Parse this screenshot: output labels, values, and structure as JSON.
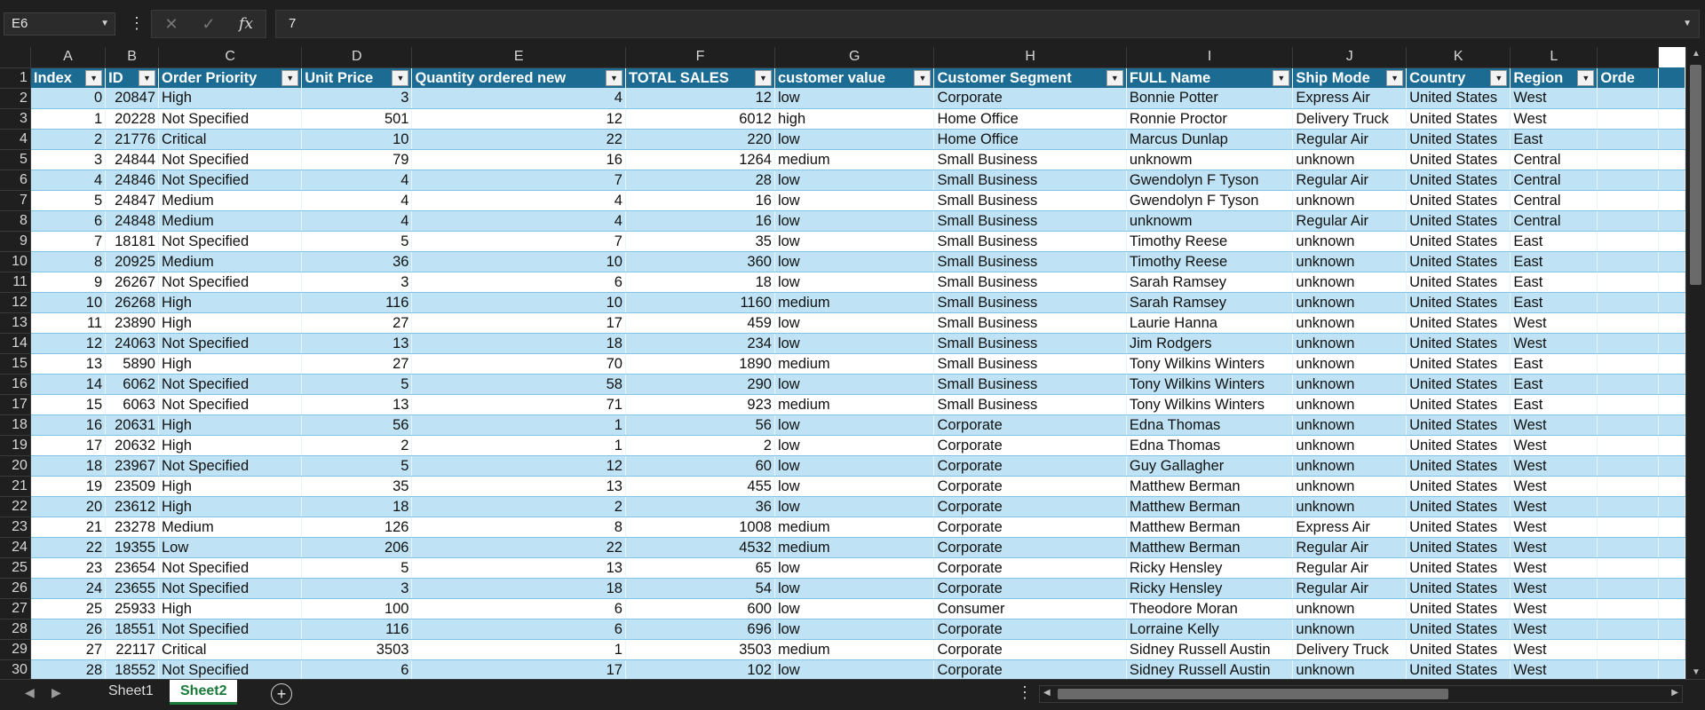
{
  "formula_bar": {
    "name_box": "E6",
    "formula_value": "7",
    "fx_label": "fx",
    "cancel_icon": "✕",
    "enter_icon": "✓"
  },
  "columns": [
    "A",
    "B",
    "C",
    "D",
    "E",
    "F",
    "G",
    "H",
    "I",
    "J",
    "K",
    "L",
    ""
  ],
  "headers": [
    "Index",
    "ID",
    "Order Priority",
    "Unit Price",
    "Quantity ordered new",
    "TOTAL SALES",
    "customer value",
    "Customer Segment",
    "FULL Name",
    "Ship Mode",
    "Country",
    "Region",
    "Orde"
  ],
  "header_row_number": "1",
  "rows": [
    {
      "n": "2",
      "v": [
        "0",
        "20847",
        "High",
        "3",
        "4",
        "12",
        "low",
        "Corporate",
        "Bonnie Potter",
        "Express Air",
        "United States",
        "West",
        ""
      ]
    },
    {
      "n": "3",
      "v": [
        "1",
        "20228",
        "Not Specified",
        "501",
        "12",
        "6012",
        "high",
        "Home Office",
        "Ronnie Proctor",
        "Delivery Truck",
        "United States",
        "West",
        ""
      ]
    },
    {
      "n": "4",
      "v": [
        "2",
        "21776",
        "Critical",
        "10",
        "22",
        "220",
        "low",
        "Home Office",
        "Marcus Dunlap",
        "Regular Air",
        "United States",
        "East",
        ""
      ]
    },
    {
      "n": "5",
      "v": [
        "3",
        "24844",
        "Not Specified",
        "79",
        "16",
        "1264",
        "medium",
        "Small Business",
        "unknowm",
        "unknown",
        "United States",
        "Central",
        ""
      ]
    },
    {
      "n": "6",
      "v": [
        "4",
        "24846",
        "Not Specified",
        "4",
        "7",
        "28",
        "low",
        "Small Business",
        "Gwendolyn F Tyson",
        "Regular Air",
        "United States",
        "Central",
        ""
      ]
    },
    {
      "n": "7",
      "v": [
        "5",
        "24847",
        "Medium",
        "4",
        "4",
        "16",
        "low",
        "Small Business",
        "Gwendolyn F Tyson",
        "unknown",
        "United States",
        "Central",
        ""
      ]
    },
    {
      "n": "8",
      "v": [
        "6",
        "24848",
        "Medium",
        "4",
        "4",
        "16",
        "low",
        "Small Business",
        "unknowm",
        "Regular Air",
        "United States",
        "Central",
        ""
      ]
    },
    {
      "n": "9",
      "v": [
        "7",
        "18181",
        "Not Specified",
        "5",
        "7",
        "35",
        "low",
        "Small Business",
        "Timothy Reese",
        "unknown",
        "United States",
        "East",
        ""
      ]
    },
    {
      "n": "10",
      "v": [
        "8",
        "20925",
        "Medium",
        "36",
        "10",
        "360",
        "low",
        "Small Business",
        "Timothy Reese",
        "unknown",
        "United States",
        "East",
        ""
      ]
    },
    {
      "n": "11",
      "v": [
        "9",
        "26267",
        "Not Specified",
        "3",
        "6",
        "18",
        "low",
        "Small Business",
        "Sarah Ramsey",
        "unknown",
        "United States",
        "East",
        ""
      ]
    },
    {
      "n": "12",
      "v": [
        "10",
        "26268",
        "High",
        "116",
        "10",
        "1160",
        "medium",
        "Small Business",
        "Sarah Ramsey",
        "unknown",
        "United States",
        "East",
        ""
      ]
    },
    {
      "n": "13",
      "v": [
        "11",
        "23890",
        "High",
        "27",
        "17",
        "459",
        "low",
        "Small Business",
        "Laurie Hanna",
        "unknown",
        "United States",
        "West",
        ""
      ]
    },
    {
      "n": "14",
      "v": [
        "12",
        "24063",
        "Not Specified",
        "13",
        "18",
        "234",
        "low",
        "Small Business",
        "Jim Rodgers",
        "unknown",
        "United States",
        "West",
        ""
      ]
    },
    {
      "n": "15",
      "v": [
        "13",
        "5890",
        "High",
        "27",
        "70",
        "1890",
        "medium",
        "Small Business",
        "Tony Wilkins Winters",
        "unknown",
        "United States",
        "East",
        ""
      ]
    },
    {
      "n": "16",
      "v": [
        "14",
        "6062",
        "Not Specified",
        "5",
        "58",
        "290",
        "low",
        "Small Business",
        "Tony Wilkins Winters",
        "unknown",
        "United States",
        "East",
        ""
      ]
    },
    {
      "n": "17",
      "v": [
        "15",
        "6063",
        "Not Specified",
        "13",
        "71",
        "923",
        "medium",
        "Small Business",
        "Tony Wilkins Winters",
        "unknown",
        "United States",
        "East",
        ""
      ]
    },
    {
      "n": "18",
      "v": [
        "16",
        "20631",
        "High",
        "56",
        "1",
        "56",
        "low",
        "Corporate",
        "Edna Thomas",
        "unknown",
        "United States",
        "West",
        ""
      ]
    },
    {
      "n": "19",
      "v": [
        "17",
        "20632",
        "High",
        "2",
        "1",
        "2",
        "low",
        "Corporate",
        "Edna Thomas",
        "unknown",
        "United States",
        "West",
        ""
      ]
    },
    {
      "n": "20",
      "v": [
        "18",
        "23967",
        "Not Specified",
        "5",
        "12",
        "60",
        "low",
        "Corporate",
        "Guy Gallagher",
        "unknown",
        "United States",
        "West",
        ""
      ]
    },
    {
      "n": "21",
      "v": [
        "19",
        "23509",
        "High",
        "35",
        "13",
        "455",
        "low",
        "Corporate",
        "Matthew Berman",
        "unknown",
        "United States",
        "West",
        ""
      ]
    },
    {
      "n": "22",
      "v": [
        "20",
        "23612",
        "High",
        "18",
        "2",
        "36",
        "low",
        "Corporate",
        "Matthew Berman",
        "unknown",
        "United States",
        "West",
        ""
      ]
    },
    {
      "n": "23",
      "v": [
        "21",
        "23278",
        "Medium",
        "126",
        "8",
        "1008",
        "medium",
        "Corporate",
        "Matthew Berman",
        "Express Air",
        "United States",
        "West",
        ""
      ]
    },
    {
      "n": "24",
      "v": [
        "22",
        "19355",
        "Low",
        "206",
        "22",
        "4532",
        "medium",
        "Corporate",
        "Matthew Berman",
        "Regular Air",
        "United States",
        "West",
        ""
      ]
    },
    {
      "n": "25",
      "v": [
        "23",
        "23654",
        "Not Specified",
        "5",
        "13",
        "65",
        "low",
        "Corporate",
        "Ricky Hensley",
        "Regular Air",
        "United States",
        "West",
        ""
      ]
    },
    {
      "n": "26",
      "v": [
        "24",
        "23655",
        "Not Specified",
        "3",
        "18",
        "54",
        "low",
        "Corporate",
        "Ricky Hensley",
        "Regular Air",
        "United States",
        "West",
        ""
      ]
    },
    {
      "n": "27",
      "v": [
        "25",
        "25933",
        "High",
        "100",
        "6",
        "600",
        "low",
        "Consumer",
        "Theodore Moran",
        "unknown",
        "United States",
        "West",
        ""
      ]
    },
    {
      "n": "28",
      "v": [
        "26",
        "18551",
        "Not Specified",
        "116",
        "6",
        "696",
        "low",
        "Corporate",
        "Lorraine Kelly",
        "unknown",
        "United States",
        "West",
        ""
      ]
    },
    {
      "n": "29",
      "v": [
        "27",
        "22117",
        "Critical",
        "3503",
        "1",
        "3503",
        "medium",
        "Corporate",
        "Sidney Russell Austin",
        "Delivery Truck",
        "United States",
        "West",
        ""
      ]
    },
    {
      "n": "30",
      "v": [
        "28",
        "18552",
        "Not Specified",
        "6",
        "17",
        "102",
        "low",
        "Corporate",
        "Sidney Russell Austin",
        "unknown",
        "United States",
        "West",
        ""
      ]
    }
  ],
  "numeric_columns": [
    0,
    1,
    3,
    4,
    5
  ],
  "sheet_tabs": {
    "tabs": [
      "Sheet1",
      "Sheet2"
    ],
    "active": "Sheet2",
    "add_label": "+"
  }
}
